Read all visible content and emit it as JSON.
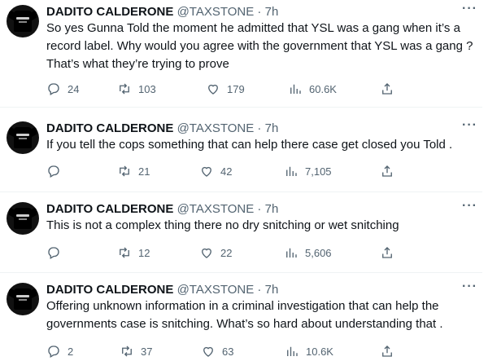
{
  "tweets": [
    {
      "name": "DADITO CALDERONE",
      "handle": "@TAXSTONE",
      "time": "7h",
      "text": "So yes Gunna Told the moment he admitted that YSL was a gang when it’s a record label. Why would you agree with the government that YSL was a gang ? That’s what they’re trying to prove",
      "replies": "24",
      "retweets": "103",
      "likes": "179",
      "views": "60.6K"
    },
    {
      "name": "DADITO CALDERONE",
      "handle": "@TAXSTONE",
      "time": "7h",
      "text": "If you tell the cops something that can help there case get closed you Told .",
      "replies": "",
      "retweets": "21",
      "likes": "42",
      "views": "7,105"
    },
    {
      "name": "DADITO CALDERONE",
      "handle": "@TAXSTONE",
      "time": "7h",
      "text": "This is not a complex thing there no dry snitching or wet snitching",
      "replies": "",
      "retweets": "12",
      "likes": "22",
      "views": "5,606"
    },
    {
      "name": "DADITO CALDERONE",
      "handle": "@TAXSTONE",
      "time": "7h",
      "text": "Offering  unknown information in a criminal investigation that can help the governments case is snitching. What’s so hard about understanding that .",
      "replies": "2",
      "retweets": "37",
      "likes": "63",
      "views": "10.6K"
    }
  ],
  "icons": {
    "reply": "reply-icon",
    "retweet": "retweet-icon",
    "like": "heart-icon",
    "views": "analytics-icon",
    "share": "share-icon",
    "more": "more-icon"
  },
  "colors": {
    "text": "#0f1419",
    "secondary": "#536471",
    "divider": "#eff3f4"
  }
}
